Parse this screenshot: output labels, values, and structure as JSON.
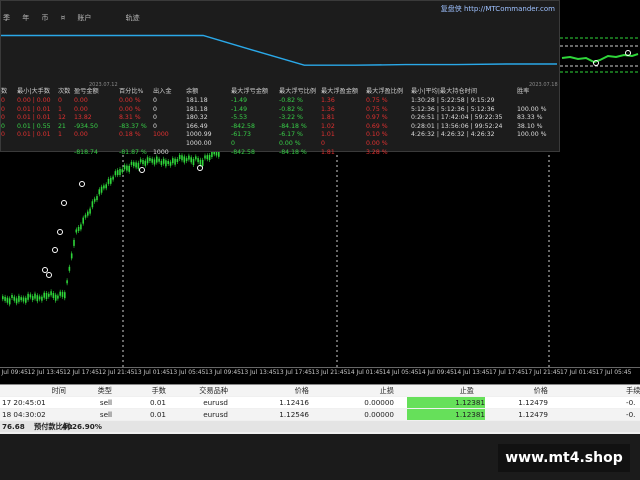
{
  "panel": {
    "menu": [
      "季",
      "年",
      "币",
      "¤",
      "账户",
      "轨迹"
    ],
    "brand_name": "复盘侠",
    "brand_url": "http://MTCommander.com",
    "date_left": "2023.07.12",
    "date_right": "2023.07.18",
    "headers": [
      "数",
      "最小|大手数",
      "次数",
      "盈亏金额",
      "百分比%",
      "出入金",
      "余额",
      "最大浮亏金额",
      "最大浮亏比例",
      "最大浮盈金额",
      "最大浮盈比例",
      "最小|平均|最大持仓时间",
      "胜率"
    ],
    "rows": [
      [
        "0",
        "0.00 | 0.00",
        "0",
        "0.00",
        "0.00 %",
        "0",
        "181.18",
        "-1.49",
        "-0.82 %",
        "1.36",
        "0.75 %",
        "1:30:28 | 5:22:58 | 9:15:29",
        ""
      ],
      [
        "0",
        "0.01 | 0.01",
        "1",
        "0.00",
        "0.00 %",
        "0",
        "181.18",
        "-1.49",
        "-0.82 %",
        "1.36",
        "0.75 %",
        "5:12:36 | 5:12:36 | 5:12:36",
        "100.00 %"
      ],
      [
        "0",
        "0.01 | 0.01",
        "12",
        "13.82",
        "8.31 %",
        "0",
        "180.32",
        "-5.53",
        "-3.22 %",
        "1.81",
        "0.97 %",
        "0:26:51 | 17:42:04 | 59:22:35",
        "83.33 %"
      ],
      [
        "0",
        "0.01 | 0.55",
        "21",
        "-934.50",
        "-83.37 %",
        "0",
        "166.49",
        "-842.58",
        "-84.18 %",
        "1.02",
        "0.69 %",
        "0:28:01 | 13:56:06 | 99:52:24",
        "38.10 %"
      ],
      [
        "0",
        "0.01 | 0.01",
        "1",
        "0.00",
        "0.18 %",
        "1000",
        "1000.99",
        "-61.73",
        "-6.17 %",
        "1.01",
        "0.10 %",
        "4:26:32 | 4:26:32 | 4:26:32",
        "100.00 %"
      ],
      [
        "",
        "",
        "",
        "",
        "",
        "",
        "1000.00",
        "0",
        "0.00 %",
        "0",
        "0.00 %",
        "",
        ""
      ],
      [
        "",
        "",
        "",
        "-818.74",
        "-81.87 %",
        "1000",
        "",
        "-842.58",
        "-84.18 %",
        "1.81",
        "3.28 %",
        "",
        ""
      ]
    ],
    "row_colors": [
      "red",
      "red",
      "red",
      "green",
      "red",
      "white",
      "green"
    ]
  },
  "chart_data": {
    "type": "line",
    "title": "",
    "x_ticks": [
      "12 Jul 09:45",
      "12 Jul 13:45",
      "12 Jul 17:45",
      "12 Jul 21:45",
      "13 Jul 01:45",
      "13 Jul 05:45",
      "13 Jul 09:45",
      "13 Jul 13:45",
      "13 Jul 17:45",
      "13 Jul 21:45",
      "14 Jul 01:45",
      "14 Jul 05:45",
      "14 Jul 09:45",
      "14 Jul 13:45",
      "17 Jul 17:45",
      "17 Jul 21:45",
      "17 Jul 01:45",
      "17 Jul 05:45"
    ],
    "series": [
      {
        "values": [
          0.2,
          0.21,
          0.2,
          0.22,
          0.21,
          0.23,
          0.22,
          0.24,
          0.55,
          0.63,
          0.72,
          0.8,
          0.85,
          0.9,
          0.92,
          0.94,
          0.95,
          0.96,
          0.94,
          0.95,
          0.97,
          0.96,
          0.95,
          0.98,
          1.0
        ]
      }
    ],
    "balance_curve": [
      0.78,
      0.78,
      0.78,
      0.78,
      0.78,
      0.52,
      0.26,
      0.26,
      0.27,
      0.27,
      0.28,
      0.28
    ]
  },
  "orders": {
    "headers": [
      "时间",
      "类型",
      "手数",
      "交易品种",
      "价格",
      "止损",
      "止盈",
      "价格",
      "手续"
    ],
    "rows": [
      [
        "17 20:45:01",
        "sell",
        "0.01",
        "eurusd",
        "1.12416",
        "0.00000",
        "1.12381",
        "1.12479",
        "-0."
      ],
      [
        "18 04:30:02",
        "sell",
        "0.01",
        "eurusd",
        "1.12546",
        "0.00000",
        "1.12381",
        "1.12479",
        "-0."
      ]
    ],
    "summary_value": "76.68",
    "summary_label": "预付款比例:",
    "summary_pct": "4026.90%"
  },
  "watermark": "www.mt4.shop",
  "colors": {
    "candle": "#2fd63a",
    "balance_line": "#2aa8e8",
    "grid_dashed": "#dcdcdc",
    "tp_highlight": "#66e05a"
  }
}
